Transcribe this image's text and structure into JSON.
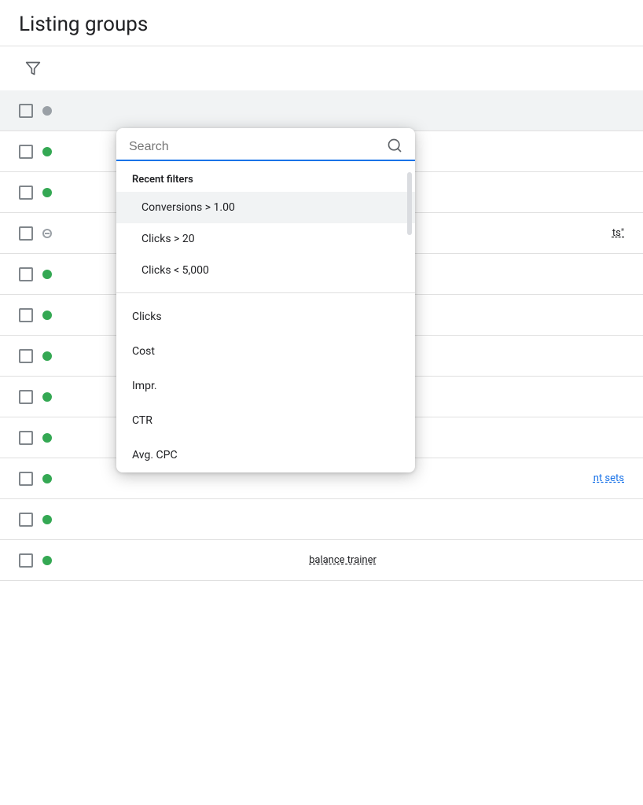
{
  "page": {
    "title": "Listing groups"
  },
  "toolbar": {
    "filter_icon_label": "Filter",
    "filter_icon": "▽"
  },
  "table": {
    "rows": [
      {
        "id": 1,
        "status": "gray",
        "highlighted": true,
        "text": ""
      },
      {
        "id": 2,
        "status": "green",
        "highlighted": false,
        "text": ""
      },
      {
        "id": 3,
        "status": "green",
        "highlighted": false,
        "text": ""
      },
      {
        "id": 4,
        "status": "dash",
        "highlighted": false,
        "text": "ts\""
      },
      {
        "id": 5,
        "status": "green",
        "highlighted": false,
        "text": ""
      },
      {
        "id": 6,
        "status": "green",
        "highlighted": false,
        "text": ""
      },
      {
        "id": 7,
        "status": "green",
        "highlighted": false,
        "text": ""
      },
      {
        "id": 8,
        "status": "green",
        "highlighted": false,
        "text": ""
      },
      {
        "id": 9,
        "status": "green",
        "highlighted": false,
        "text": ""
      },
      {
        "id": 10,
        "status": "green",
        "highlighted": false,
        "text": "nt sets",
        "dashed": true
      },
      {
        "id": 11,
        "status": "green",
        "highlighted": false,
        "text": ""
      }
    ],
    "bottom_row_text": "balance trainer",
    "bottom_row_dashed": true
  },
  "dropdown": {
    "search_placeholder": "Search",
    "search_icon": "🔍",
    "section_label": "Recent filters",
    "recent_items": [
      {
        "id": 1,
        "label": "Conversions > 1.00",
        "active": true
      },
      {
        "id": 2,
        "label": "Clicks > 20",
        "active": false
      },
      {
        "id": 3,
        "label": "Clicks < 5,000",
        "active": false
      }
    ],
    "filter_items": [
      {
        "id": 1,
        "label": "Clicks"
      },
      {
        "id": 2,
        "label": "Cost"
      },
      {
        "id": 3,
        "label": "Impr."
      },
      {
        "id": 4,
        "label": "CTR"
      },
      {
        "id": 5,
        "label": "Avg. CPC"
      }
    ]
  }
}
